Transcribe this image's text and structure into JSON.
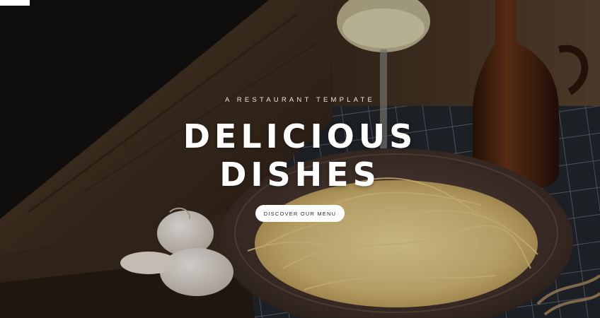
{
  "hero": {
    "tagline": "A RESTAURANT TEMPLATE",
    "title_line_1": "DELICIOUS",
    "title_line_2": "DISHES",
    "cta_label": "DISCOVER OUR MENU"
  },
  "colors": {
    "background": "#141210",
    "text": "#ffffff",
    "button_bg": "#ffffff",
    "button_text": "#2b2b2b"
  }
}
